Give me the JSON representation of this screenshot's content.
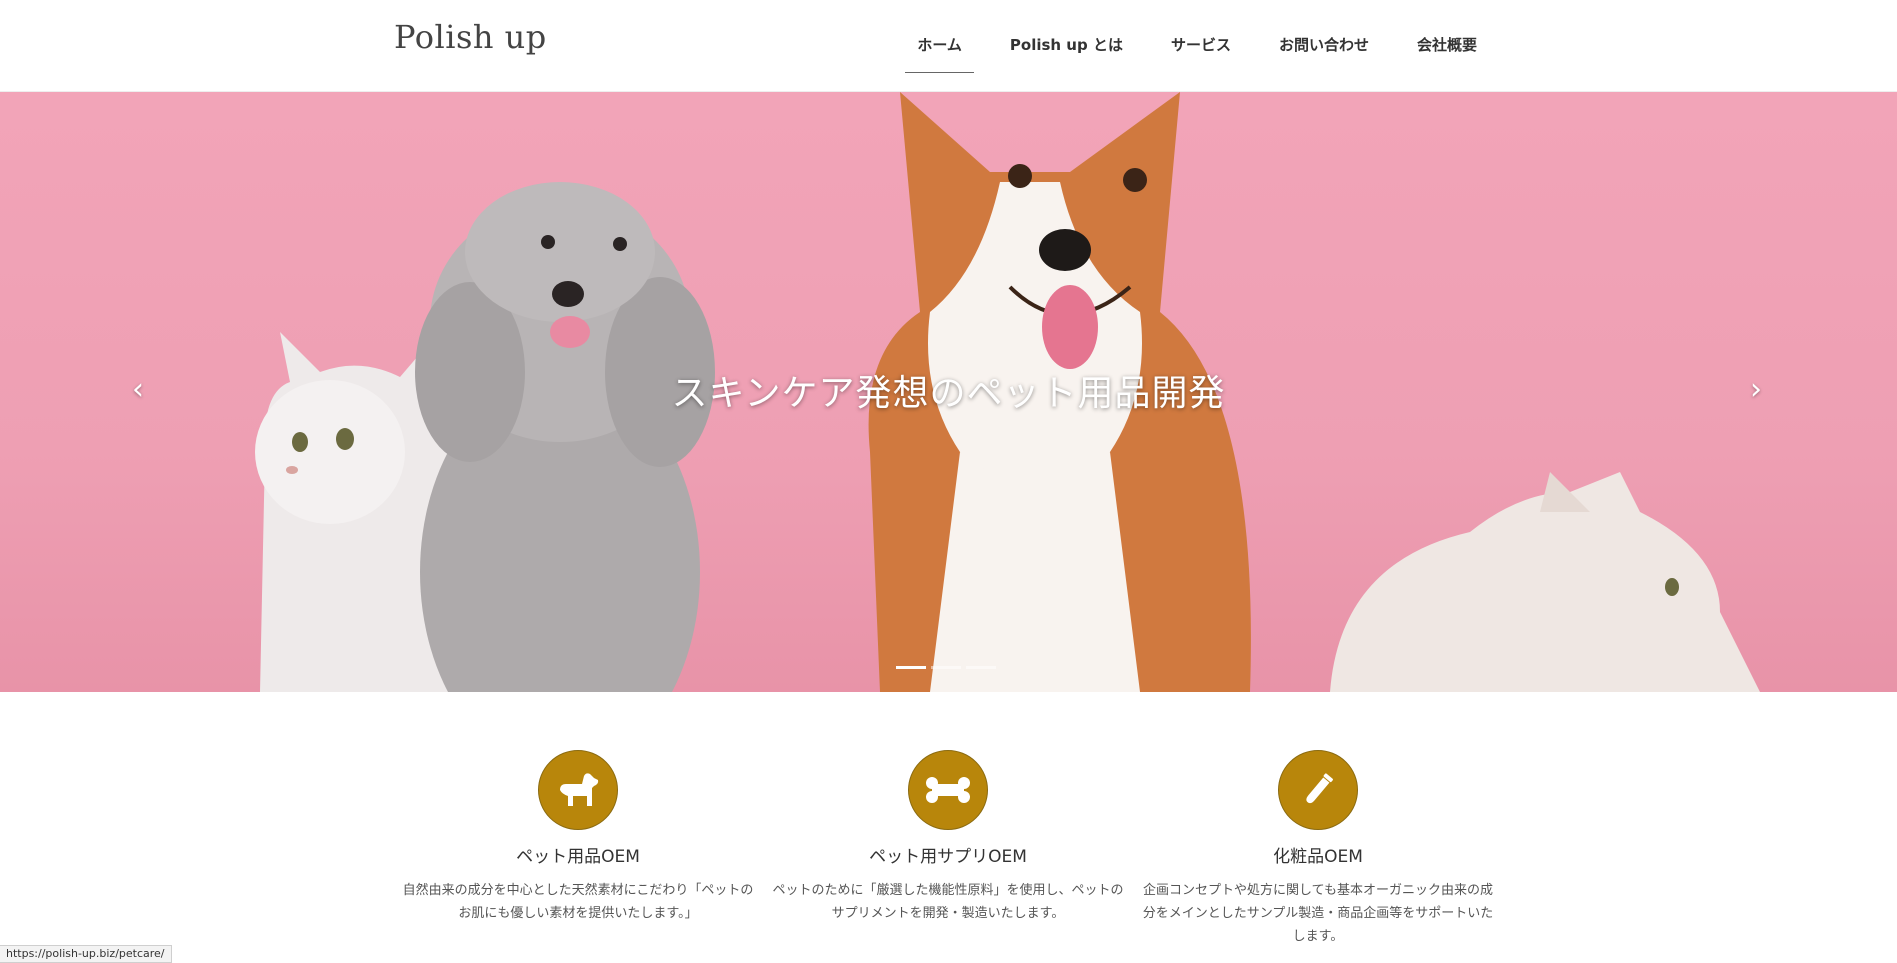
{
  "header": {
    "logo": "Polish up",
    "nav": [
      {
        "label": "ホーム",
        "active": true
      },
      {
        "label": "Polish up とは",
        "active": false
      },
      {
        "label": "サービス",
        "active": false
      },
      {
        "label": "お問い合わせ",
        "active": false
      },
      {
        "label": "会社概要",
        "active": false
      }
    ]
  },
  "hero": {
    "title": "スキンケア発想のペット用品開発",
    "prev_icon": "chevron-left-icon",
    "next_icon": "chevron-right-icon",
    "slide_count": 3,
    "active_slide": 1,
    "background_color": "#f2a4b8"
  },
  "services": [
    {
      "icon": "dog-icon",
      "title": "ペット用品OEM",
      "text": "自然由来の成分を中心とした天然素材にこだわり「ペットのお肌にも優しい素材を提供いたします。」"
    },
    {
      "icon": "bone-icon",
      "title": "ペット用サプリOEM",
      "text": "ペットのために「厳選した機能性原料」を使用し、ペットのサプリメントを開発・製造いたします。"
    },
    {
      "icon": "test-tube-icon",
      "title": "化粧品OEM",
      "text": "企画コンセプトや処方に関しても基本オーガニック由来の成分をメインとしたサンプル製造・商品企画等をサポートいたします。"
    }
  ],
  "accent_color": "#b8860b",
  "status_bar": {
    "url": "https://polish-up.biz/petcare/"
  }
}
